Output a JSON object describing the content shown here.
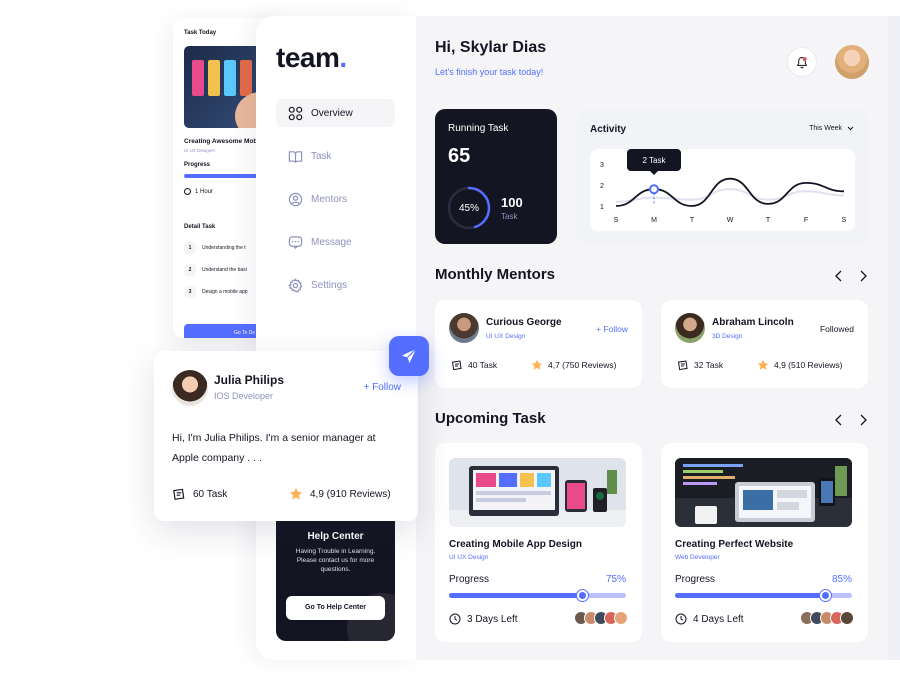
{
  "task_today": {
    "title": "Task Today",
    "task_name": "Creating Awesome Mob",
    "task_role": "UI UX Designer",
    "progress_label": "Progress",
    "time": "1 Hour",
    "detail_label": "Detail Task",
    "steps": [
      {
        "num": "1",
        "text": "Understanding the t"
      },
      {
        "num": "2",
        "text": "Understand the basi"
      },
      {
        "num": "3",
        "text": "Design a mobile app"
      }
    ],
    "go_label": "Go To De"
  },
  "sidebar": {
    "logo": "team",
    "logo_dot": ".",
    "items": [
      {
        "label": "Overview",
        "active": true
      },
      {
        "label": "Task"
      },
      {
        "label": "Mentors"
      },
      {
        "label": "Message"
      },
      {
        "label": "Settings"
      }
    ],
    "help": {
      "title": "Help Center",
      "description": "Having Trouble in Learning. Please contact us for more questions.",
      "button": "Go To Help Center"
    }
  },
  "header": {
    "greeting": "Hi, Skylar Dias",
    "subtitle": "Let's finish your task today!"
  },
  "running_task": {
    "label": "Running Task",
    "value": "65",
    "percent": "45%",
    "percent_value": 45,
    "total": "100",
    "total_label": "Task"
  },
  "activity": {
    "title": "Activity",
    "filter": "This Week",
    "tooltip": "2 Task"
  },
  "chart_data": {
    "type": "line",
    "title": "Activity",
    "categories": [
      "S",
      "M",
      "T",
      "W",
      "T",
      "F",
      "S"
    ],
    "y_ticks": [
      "1",
      "2",
      "3"
    ],
    "ylim": [
      1,
      3
    ],
    "series": [
      {
        "values": [
          1.0,
          1.8,
          1.0,
          2.3,
          1.1,
          2.1,
          1.7
        ]
      },
      {
        "values": [
          1.2,
          1.4,
          1.3,
          1.8,
          1.3,
          1.7,
          1.5
        ]
      }
    ],
    "highlight_index": 1,
    "grid": false
  },
  "monthly_mentors": {
    "title": "Monthly Mentors",
    "mentors": [
      {
        "name": "Curious George",
        "role": "UI UX Design",
        "follow": "+ Follow",
        "tasks": "40 Task",
        "rating": "4,7 (750 Reviews)"
      },
      {
        "name": "Abraham Lincoln",
        "role": "3D Design",
        "follow": "Followed",
        "tasks": "32 Task",
        "rating": "4,9 (510 Reviews)"
      }
    ]
  },
  "upcoming_task": {
    "title": "Upcoming Task",
    "tasks": [
      {
        "title": "Creating Mobile App Design",
        "role": "UI UX Design",
        "progress_label": "Progress",
        "percent": "75%",
        "percent_value": 75,
        "days_left": "3 Days Left"
      },
      {
        "title": "Creating Perfect Website",
        "role": "Web Developer",
        "progress_label": "Progress",
        "percent": "85%",
        "percent_value": 85,
        "days_left": "4 Days Left"
      }
    ]
  },
  "profile": {
    "name": "Julia Philips",
    "role": "IOS Developer",
    "follow": "+ Follow",
    "bio": "Hi, I'm Julia Philips. I'm a senior manager at Apple company . . .",
    "tasks": "60 Task",
    "rating": "4,9 (910 Reviews)"
  },
  "colors": {
    "accent": "#546FFF",
    "dark": "#141522",
    "muted": "#8E92BC",
    "star": "#FFB054",
    "bell_dot": "#DB5962"
  }
}
